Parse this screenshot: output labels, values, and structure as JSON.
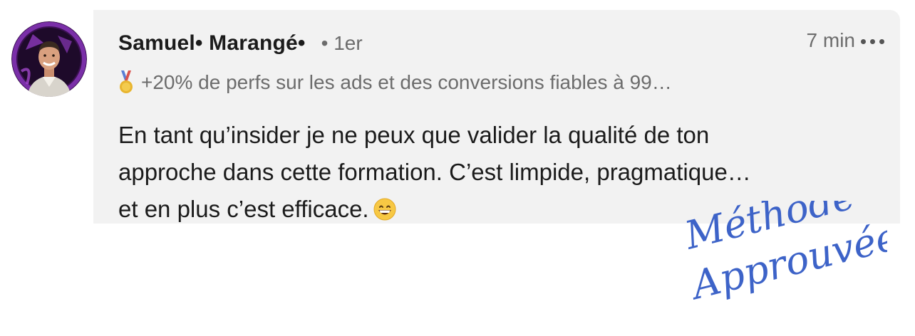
{
  "comment": {
    "author": "Samuel• Marangé•",
    "connection_degree": "• 1er",
    "time": "7 min",
    "headline": "+20% de perfs sur les ads et des conversions fiables à 99…",
    "body_lines": [
      "En tant qu’insider je ne peux que valider la qualité de ton",
      "approche dans cette formation. C’est limpide, pragmatique…",
      "et en plus c’est efficace."
    ],
    "body_emoji": "grinning-face-emoji"
  },
  "annotation": {
    "line1": "Méthode",
    "line2": "Approuvée",
    "color": "#3d63c8"
  },
  "colors": {
    "bubble_background": "#f2f2f2",
    "avatar_ring": "#7a2fa8",
    "text_primary": "#1b1b1b",
    "text_secondary": "#6c6c6c"
  },
  "icons": {
    "more": "more-dots-icon",
    "medal": "medal-icon",
    "avatar": "profile-photo"
  }
}
